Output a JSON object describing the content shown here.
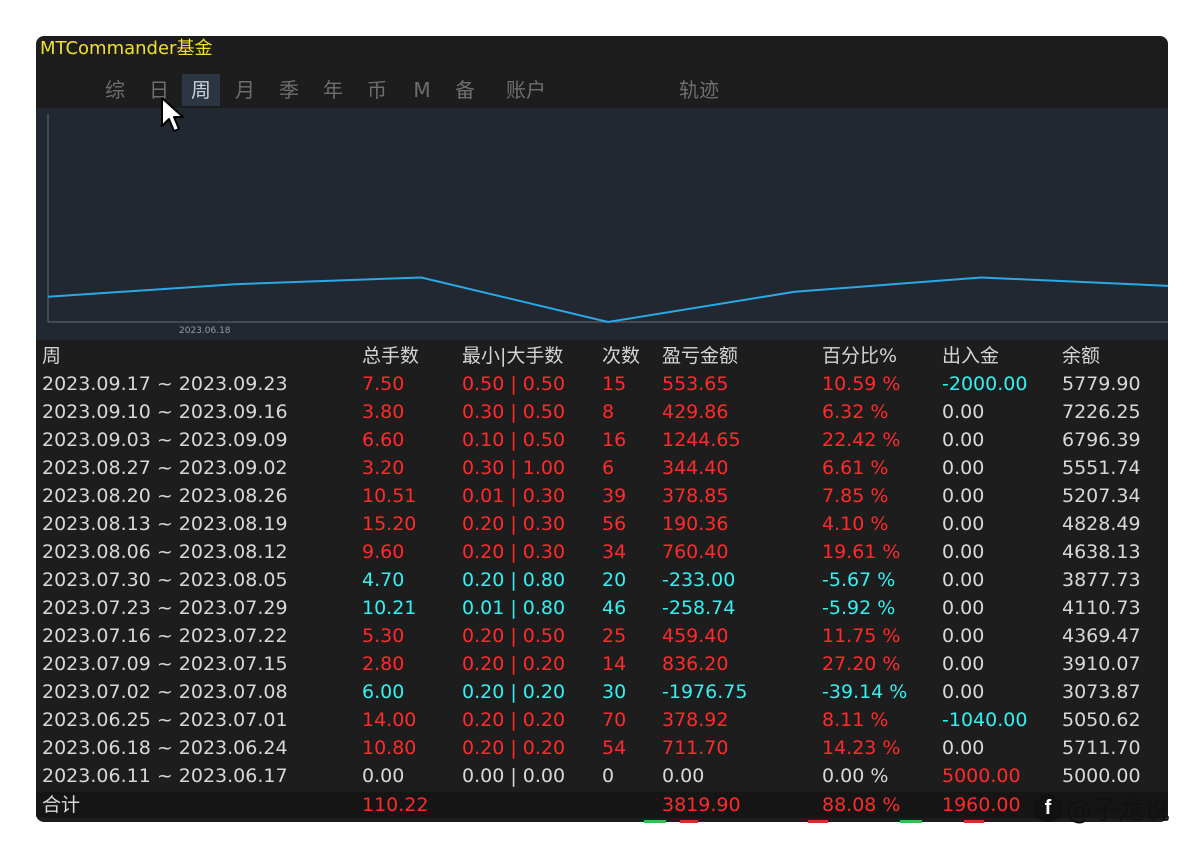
{
  "app": {
    "title": "MTCommander基金"
  },
  "tabs": [
    {
      "label": "综"
    },
    {
      "label": "日"
    },
    {
      "label": "周"
    },
    {
      "label": "月"
    },
    {
      "label": "季"
    },
    {
      "label": "年"
    },
    {
      "label": "币"
    },
    {
      "label": "M"
    },
    {
      "label": "备"
    },
    {
      "label": "账户"
    },
    {
      "label": "轨迹"
    }
  ],
  "active_tab": "周",
  "chart_data": {
    "type": "line",
    "x_tick_labels": [
      "2023.06.18"
    ],
    "series": [
      {
        "values": [
          0.3,
          0.45,
          0.53,
          0.0,
          0.36,
          0.53,
          0.43
        ]
      }
    ],
    "ylim": [
      0,
      1
    ],
    "grid": false,
    "color": "#2aa8e8"
  },
  "table": {
    "headers": [
      "周",
      "总手数",
      "最小|大手数",
      "次数",
      "盈亏金额",
      "百分比%",
      "出入金",
      "余额"
    ],
    "rows": [
      {
        "week": "2023.09.17 ~ 2023.09.23",
        "lots": "7.50",
        "minmax": "0.50 | 0.50",
        "count": "15",
        "pl": "553.65",
        "pct": "10.59 %",
        "flow": "-2000.00",
        "balance": "5779.90",
        "c": "red",
        "fc": "cyan"
      },
      {
        "week": "2023.09.10 ~ 2023.09.16",
        "lots": "3.80",
        "minmax": "0.30 | 0.50",
        "count": "8",
        "pl": "429.86",
        "pct": "6.32 %",
        "flow": "0.00",
        "balance": "7226.25",
        "c": "red",
        "fc": "white"
      },
      {
        "week": "2023.09.03 ~ 2023.09.09",
        "lots": "6.60",
        "minmax": "0.10 | 0.50",
        "count": "16",
        "pl": "1244.65",
        "pct": "22.42 %",
        "flow": "0.00",
        "balance": "6796.39",
        "c": "red",
        "fc": "white"
      },
      {
        "week": "2023.08.27 ~ 2023.09.02",
        "lots": "3.20",
        "minmax": "0.30 | 1.00",
        "count": "6",
        "pl": "344.40",
        "pct": "6.61 %",
        "flow": "0.00",
        "balance": "5551.74",
        "c": "red",
        "fc": "white"
      },
      {
        "week": "2023.08.20 ~ 2023.08.26",
        "lots": "10.51",
        "minmax": "0.01 | 0.30",
        "count": "39",
        "pl": "378.85",
        "pct": "7.85 %",
        "flow": "0.00",
        "balance": "5207.34",
        "c": "red",
        "fc": "white"
      },
      {
        "week": "2023.08.13 ~ 2023.08.19",
        "lots": "15.20",
        "minmax": "0.20 | 0.30",
        "count": "56",
        "pl": "190.36",
        "pct": "4.10 %",
        "flow": "0.00",
        "balance": "4828.49",
        "c": "red",
        "fc": "white"
      },
      {
        "week": "2023.08.06 ~ 2023.08.12",
        "lots": "9.60",
        "minmax": "0.20 | 0.30",
        "count": "34",
        "pl": "760.40",
        "pct": "19.61 %",
        "flow": "0.00",
        "balance": "4638.13",
        "c": "red",
        "fc": "white"
      },
      {
        "week": "2023.07.30 ~ 2023.08.05",
        "lots": "4.70",
        "minmax": "0.20 | 0.80",
        "count": "20",
        "pl": "-233.00",
        "pct": "-5.67 %",
        "flow": "0.00",
        "balance": "3877.73",
        "c": "cyan",
        "fc": "white"
      },
      {
        "week": "2023.07.23 ~ 2023.07.29",
        "lots": "10.21",
        "minmax": "0.01 | 0.80",
        "count": "46",
        "pl": "-258.74",
        "pct": "-5.92 %",
        "flow": "0.00",
        "balance": "4110.73",
        "c": "cyan",
        "fc": "white"
      },
      {
        "week": "2023.07.16 ~ 2023.07.22",
        "lots": "5.30",
        "minmax": "0.20 | 0.50",
        "count": "25",
        "pl": "459.40",
        "pct": "11.75 %",
        "flow": "0.00",
        "balance": "4369.47",
        "c": "red",
        "fc": "white"
      },
      {
        "week": "2023.07.09 ~ 2023.07.15",
        "lots": "2.80",
        "minmax": "0.20 | 0.20",
        "count": "14",
        "pl": "836.20",
        "pct": "27.20 %",
        "flow": "0.00",
        "balance": "3910.07",
        "c": "red",
        "fc": "white"
      },
      {
        "week": "2023.07.02 ~ 2023.07.08",
        "lots": "6.00",
        "minmax": "0.20 | 0.20",
        "count": "30",
        "pl": "-1976.75",
        "pct": "-39.14 %",
        "flow": "0.00",
        "balance": "3073.87",
        "c": "cyan",
        "fc": "white"
      },
      {
        "week": "2023.06.25 ~ 2023.07.01",
        "lots": "14.00",
        "minmax": "0.20 | 0.20",
        "count": "70",
        "pl": "378.92",
        "pct": "8.11 %",
        "flow": "-1040.00",
        "balance": "5050.62",
        "c": "red",
        "fc": "cyan"
      },
      {
        "week": "2023.06.18 ~ 2023.06.24",
        "lots": "10.80",
        "minmax": "0.20 | 0.20",
        "count": "54",
        "pl": "711.70",
        "pct": "14.23 %",
        "flow": "0.00",
        "balance": "5711.70",
        "c": "red",
        "fc": "white"
      },
      {
        "week": "2023.06.11 ~ 2023.06.17",
        "lots": "0.00",
        "minmax": "0.00 | 0.00",
        "count": "0",
        "pl": "0.00",
        "pct": "0.00 %",
        "flow": "5000.00",
        "balance": "5000.00",
        "c": "white",
        "fc": "red"
      }
    ],
    "total": {
      "label": "合计",
      "lots": "110.22",
      "pl": "3819.90",
      "pct": "88.08 %",
      "flow": "1960.00"
    }
  },
  "watermark": {
    "text": "@子龙说",
    "icon": "facebook-icon"
  },
  "colors": {
    "positive": "#ff2a2a",
    "negative": "#34f0f0",
    "title": "#f0e030"
  }
}
